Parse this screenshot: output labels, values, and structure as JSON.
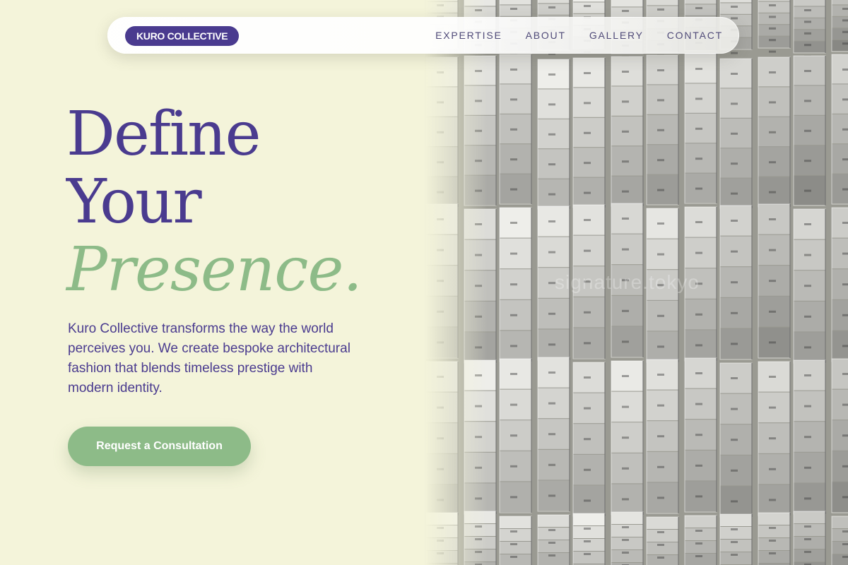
{
  "brand": {
    "name": "KURO COLLECTIVE"
  },
  "nav": {
    "links": [
      "EXPERTISE",
      "ABOUT",
      "GALLERY",
      "CONTACT"
    ]
  },
  "hero": {
    "headline_line1": "Define",
    "headline_line2": "Your",
    "headline_line3": "Presence.",
    "description": "Kuro Collective transforms the way the world perceives you. We create bespoke architectural fashion that blends timeless prestige with modern identity.",
    "cta_label": "Request a Consultation",
    "image_watermark": "signature.tokyo"
  },
  "colors": {
    "background": "#f4f4da",
    "primary": "#4a3b8f",
    "accent": "#8dbb88"
  }
}
